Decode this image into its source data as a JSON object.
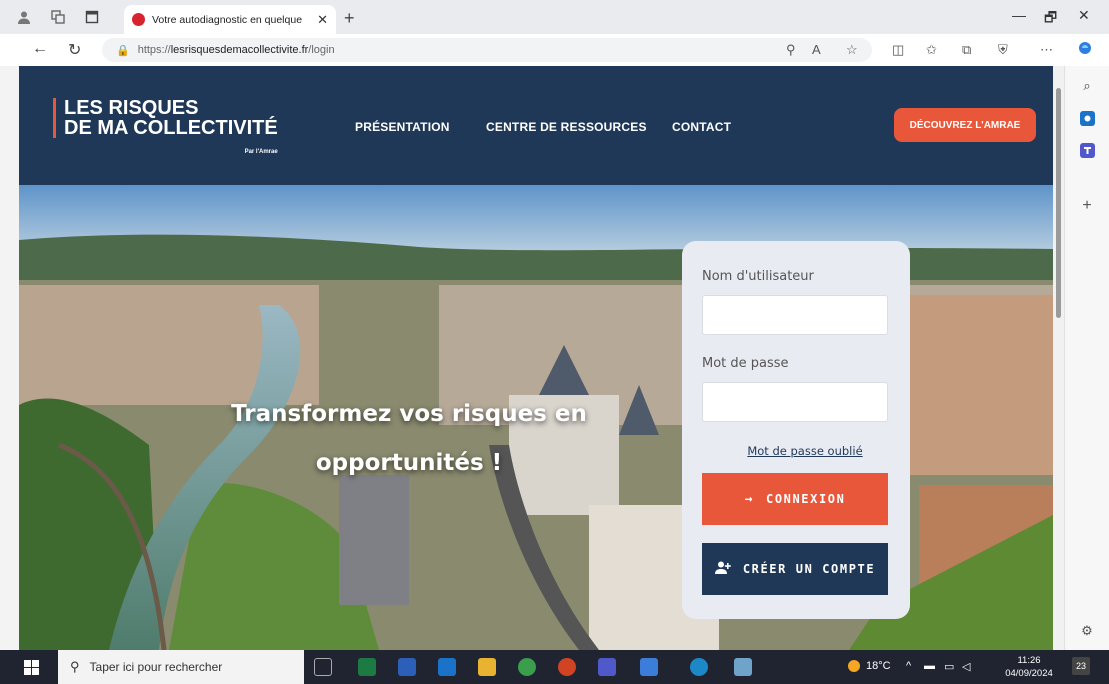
{
  "browser": {
    "tab_title": "Votre autodiagnostic en quelque",
    "tab_close": "✕",
    "new_tab": "+",
    "url_prefix": "https://",
    "url_host": "lesrisquesdemacollectivite.fr",
    "url_path": "/login",
    "window_controls": {
      "minimize": "—",
      "restore": "🗗",
      "close": "✕"
    }
  },
  "site": {
    "logo_line1": "LES RISQUES",
    "logo_line2": "DE MA COLLECTIVITÉ",
    "logo_by": "Par l'Amrae",
    "nav": [
      "PRÉSENTATION",
      "CENTRE DE RESSOURCES",
      "CONTACT"
    ],
    "cta_label": "DÉCOUVREZ L'AMRAE",
    "tagline_line1": "Transformez vos risques en",
    "tagline_line2": "opportunités !"
  },
  "login": {
    "username_label": "Nom d'utilisateur",
    "username_value": "",
    "password_label": "Mot de passe",
    "password_value": "",
    "forgot_label": "Mot de passe oublié",
    "login_button": "CONNEXION",
    "create_button": "CRÉER UN COMPTE"
  },
  "taskbar": {
    "search_placeholder": "Taper ici pour rechercher",
    "weather": "18°C",
    "time": "11:26",
    "date": "04/09/2024",
    "notifications": "23"
  },
  "colors": {
    "header_navy": "#1f3858",
    "accent_orange": "#e8573a",
    "card_bg": "#e9ebf3"
  }
}
